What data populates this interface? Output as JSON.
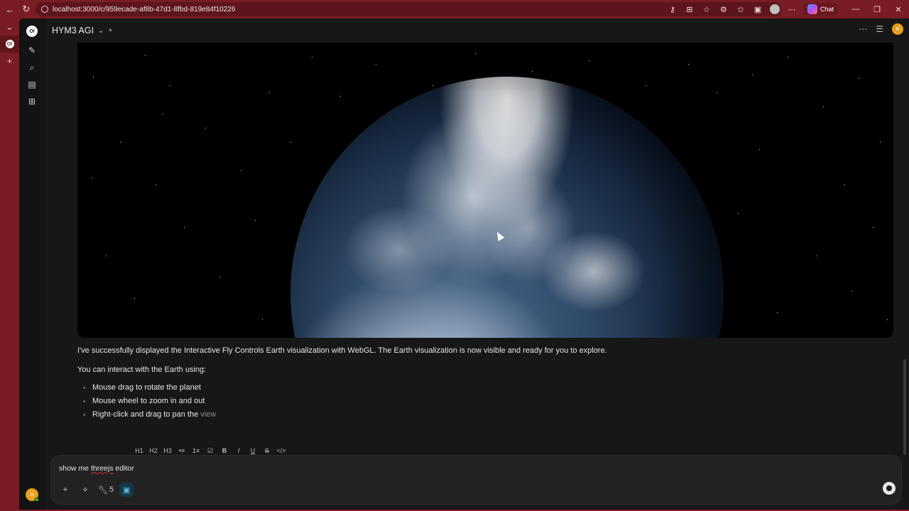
{
  "browser": {
    "url": "localhost:3000/c/959ecade-af8b-47d1-8fbd-819e84f10226",
    "chat_label": "Chat",
    "tab_favicon": "OI"
  },
  "app": {
    "logo": "OI",
    "model_name": "HYM3 AGI",
    "user_initial": "H"
  },
  "message": {
    "intro": "I've successfully displayed the Interactive Fly Controls Earth visualization with WebGL. The Earth visualization is now visible and ready for you to explore.",
    "interact_heading": "You can interact with the Earth using:",
    "items": [
      "Mouse drag to rotate the planet",
      "Mouse wheel to zoom in and out",
      "Right-click and drag to pan the"
    ],
    "last_item_fade": "view"
  },
  "format_toolbar": [
    "H1",
    "H2",
    "H3",
    "•≡",
    "1≡",
    "☑",
    "B",
    "I",
    "U",
    "S",
    "</>"
  ],
  "composer": {
    "prefix": "show me ",
    "misspelled": "threejs",
    "suffix": " editor",
    "tools_count": "5"
  },
  "icons": [
    "back-icon",
    "refresh-icon",
    "info-icon",
    "key-icon",
    "extension-icon",
    "star-icon",
    "favorites-icon",
    "profile-icon",
    "more-icon",
    "copilot-icon",
    "minimize-icon",
    "restore-icon",
    "close-icon",
    "new-chat-icon",
    "search-icon",
    "notes-icon",
    "workspace-icon",
    "settings-icon",
    "plus-icon",
    "integrations-icon",
    "wrench-icon",
    "code-interpreter-icon",
    "stop-icon"
  ]
}
